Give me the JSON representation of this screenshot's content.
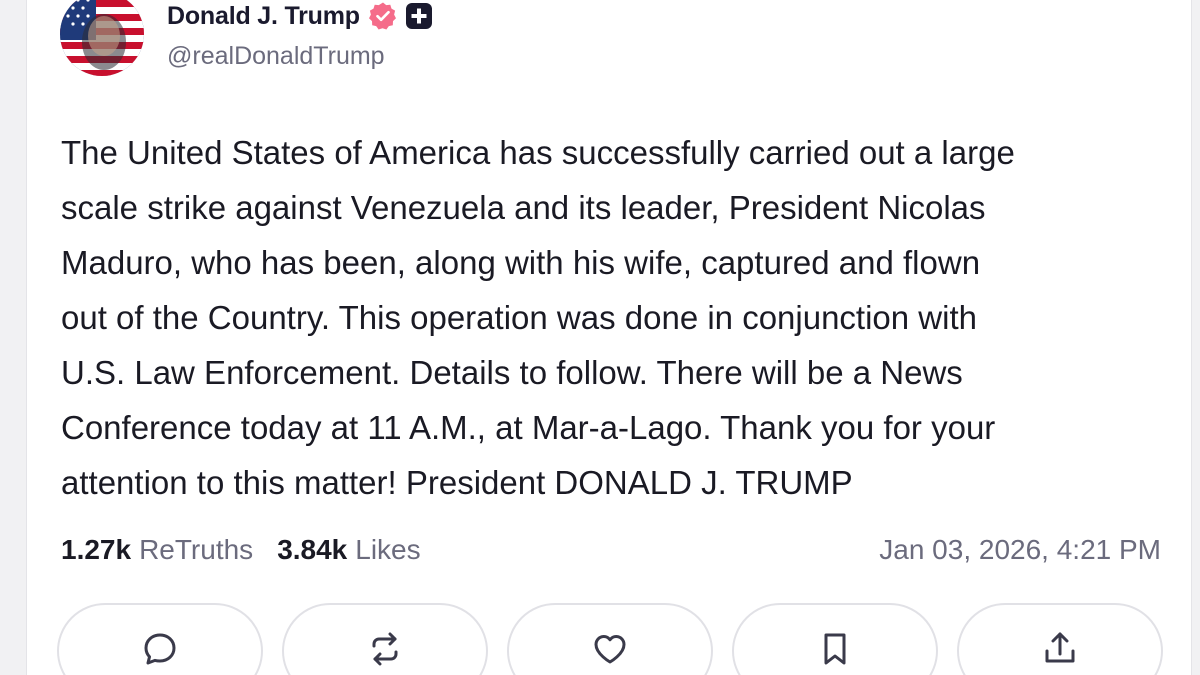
{
  "author": {
    "display_name": "Donald J. Trump",
    "handle": "@realDonaldTrump",
    "verified": true
  },
  "post": {
    "text": "The United States of America has successfully carried out a large\nscale strike against Venezuela and its leader, President Nicolas\nMaduro, who has been, along with his wife, captured and flown\nout of the Country. This operation was done in conjunction with\nU.S. Law Enforcement. Details to follow. There will be a News\nConference today at 11 A.M., at Mar-a-Lago. Thank you for your\nattention to this matter! President DONALD J. TRUMP"
  },
  "stats": {
    "retruths_count": "1.27k",
    "retruths_label": "ReTruths",
    "likes_count": "3.84k",
    "likes_label": "Likes",
    "timestamp": "Jan 03, 2026, 4:21 PM"
  },
  "actions": [
    {
      "icon": "comment-icon"
    },
    {
      "icon": "retruth-icon"
    },
    {
      "icon": "heart-icon"
    },
    {
      "icon": "bookmark-icon"
    },
    {
      "icon": "share-icon"
    }
  ],
  "colors": {
    "verified": "#f56c8a",
    "text": "#1a1a24",
    "muted": "#6b6b7d",
    "border": "#e1e1e6"
  }
}
